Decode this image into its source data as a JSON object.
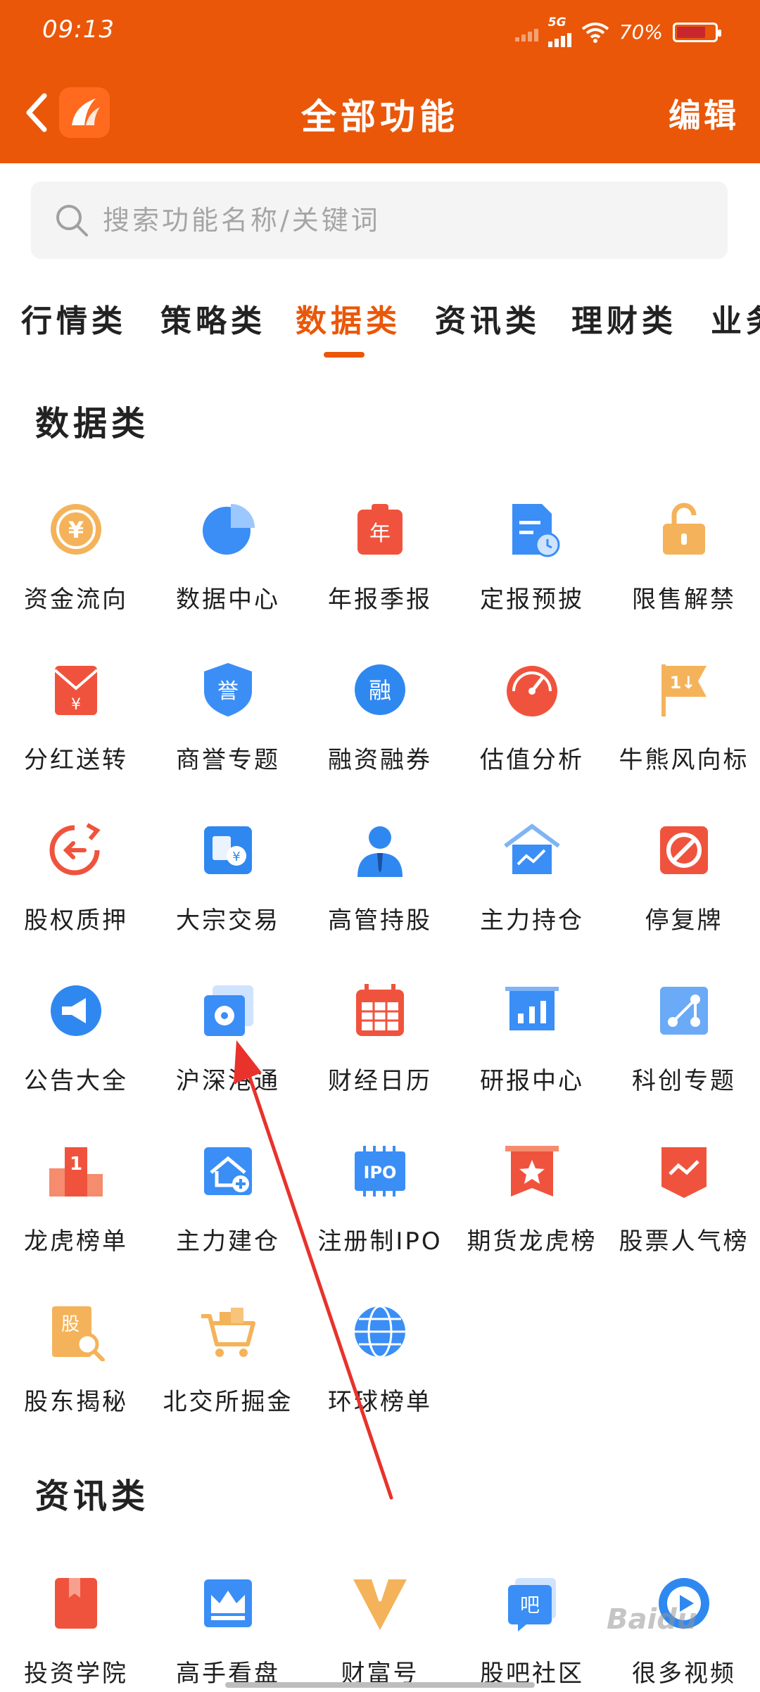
{
  "status_bar": {
    "time": "09:13",
    "network": "5G",
    "battery": "70%"
  },
  "header": {
    "title": "全部功能",
    "edit_label": "编辑"
  },
  "search": {
    "placeholder": "搜索功能名称/关键词"
  },
  "tabs": [
    {
      "label": "行情类",
      "active": false
    },
    {
      "label": "策略类",
      "active": false
    },
    {
      "label": "数据类",
      "active": true
    },
    {
      "label": "资讯类",
      "active": false
    },
    {
      "label": "理财类",
      "active": false
    },
    {
      "label": "业务",
      "active": false
    }
  ],
  "sections": [
    {
      "title": "数据类",
      "items": [
        {
          "label": "资金流向",
          "icon": "yuan-coin-icon"
        },
        {
          "label": "数据中心",
          "icon": "pie-chart-icon"
        },
        {
          "label": "年报季报",
          "icon": "annual-report-icon"
        },
        {
          "label": "定报预披",
          "icon": "document-clock-icon"
        },
        {
          "label": "限售解禁",
          "icon": "unlock-icon"
        },
        {
          "label": "分红送转",
          "icon": "red-envelope-icon"
        },
        {
          "label": "商誉专题",
          "icon": "goodwill-shield-icon"
        },
        {
          "label": "融资融券",
          "icon": "margin-trading-icon"
        },
        {
          "label": "估值分析",
          "icon": "gauge-icon"
        },
        {
          "label": "牛熊风向标",
          "icon": "bull-bear-flag-icon"
        },
        {
          "label": "股权质押",
          "icon": "equity-pledge-icon"
        },
        {
          "label": "大宗交易",
          "icon": "block-trade-icon"
        },
        {
          "label": "高管持股",
          "icon": "executive-icon"
        },
        {
          "label": "主力持仓",
          "icon": "house-chart-icon"
        },
        {
          "label": "停复牌",
          "icon": "suspension-icon"
        },
        {
          "label": "公告大全",
          "icon": "megaphone-icon"
        },
        {
          "label": "沪深港通",
          "icon": "hk-connect-icon"
        },
        {
          "label": "财经日历",
          "icon": "calendar-icon"
        },
        {
          "label": "研报中心",
          "icon": "research-chart-icon"
        },
        {
          "label": "科创专题",
          "icon": "star-market-icon"
        },
        {
          "label": "龙虎榜单",
          "icon": "podium-icon"
        },
        {
          "label": "主力建仓",
          "icon": "house-plus-icon"
        },
        {
          "label": "注册制IPO",
          "icon": "ipo-chip-icon"
        },
        {
          "label": "期货龙虎榜",
          "icon": "futures-star-icon"
        },
        {
          "label": "股票人气榜",
          "icon": "popularity-icon"
        },
        {
          "label": "股东揭秘",
          "icon": "shareholder-book-icon"
        },
        {
          "label": "北交所掘金",
          "icon": "gold-cart-icon"
        },
        {
          "label": "环球榜单",
          "icon": "globe-icon"
        }
      ]
    },
    {
      "title": "资讯类",
      "items": [
        {
          "label": "投资学院",
          "icon": "book-icon"
        },
        {
          "label": "高手看盘",
          "icon": "crown-icon"
        },
        {
          "label": "财富号",
          "icon": "pen-nib-icon"
        },
        {
          "label": "股吧社区",
          "icon": "community-icon"
        },
        {
          "label": "很多视频",
          "icon": "video-play-icon"
        }
      ]
    }
  ],
  "colors": {
    "brand": "#ea5709",
    "blue": "#3a8ef6",
    "red": "#f0533d",
    "gold": "#f4b35a"
  },
  "watermark": "Baidu"
}
